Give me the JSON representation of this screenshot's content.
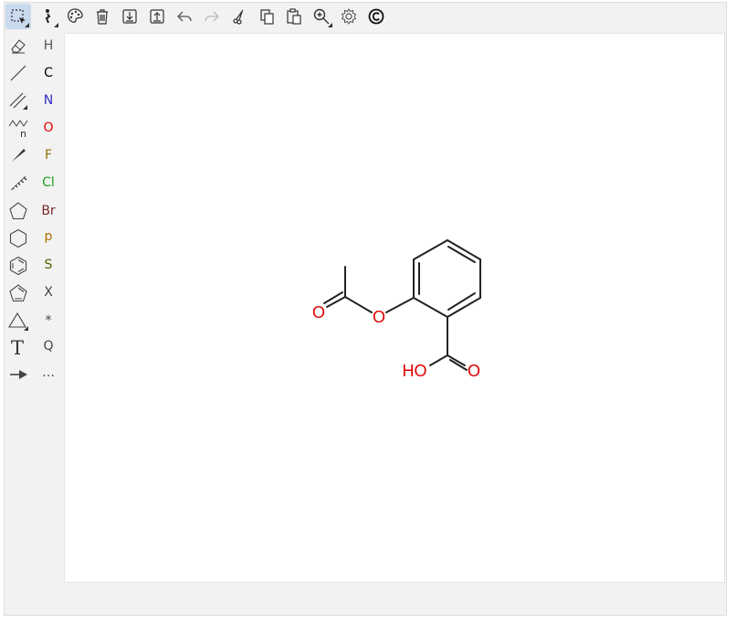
{
  "toolbar": {
    "items": [
      {
        "name": "select-tool",
        "icon": "dashed-select-icon",
        "active": true
      },
      {
        "name": "erase-tool",
        "icon": "bond-erase-icon"
      },
      {
        "name": "color-tool",
        "icon": "palette-icon"
      },
      {
        "name": "clear-tool",
        "icon": "trash-icon"
      },
      {
        "name": "open-tool",
        "icon": "download-icon"
      },
      {
        "name": "save-tool",
        "icon": "upload-icon"
      },
      {
        "name": "undo-tool",
        "icon": "undo-icon"
      },
      {
        "name": "redo-tool",
        "icon": "redo-icon"
      },
      {
        "name": "cut-tool",
        "icon": "scissors-icon"
      },
      {
        "name": "copy-tool",
        "icon": "copy-icon"
      },
      {
        "name": "paste-tool",
        "icon": "paste-icon"
      },
      {
        "name": "zoom-tool",
        "icon": "zoom-in-icon"
      },
      {
        "name": "settings-tool",
        "icon": "gear-icon"
      },
      {
        "name": "about-tool",
        "icon": "copyright-icon"
      }
    ]
  },
  "left_tools": [
    {
      "name": "eraser",
      "icon": "eraser-icon"
    },
    {
      "name": "single-bond",
      "icon": "single-bond-icon"
    },
    {
      "name": "double-bond",
      "icon": "double-bond-icon"
    },
    {
      "name": "chain",
      "icon": "chain-icon",
      "label": "n"
    },
    {
      "name": "wedge-bond",
      "icon": "wedge-bond-icon"
    },
    {
      "name": "hash-bond",
      "icon": "hash-bond-icon"
    },
    {
      "name": "cyclopentane",
      "icon": "pentagon-icon"
    },
    {
      "name": "cyclohexane",
      "icon": "hexagon-icon"
    },
    {
      "name": "benzene",
      "icon": "benzene-icon"
    },
    {
      "name": "cyclopentadiene",
      "icon": "cyclopentadiene-icon"
    },
    {
      "name": "shape",
      "icon": "triangle-icon"
    },
    {
      "name": "text",
      "icon": "text-icon",
      "label": "T"
    },
    {
      "name": "arrow",
      "icon": "arrow-icon"
    }
  ],
  "atoms": [
    {
      "label": "H",
      "color": "#555555"
    },
    {
      "label": "C",
      "color": "#000000"
    },
    {
      "label": "N",
      "color": "#3030c0"
    },
    {
      "label": "O",
      "color": "#e00000"
    },
    {
      "label": "F",
      "color": "#8a7000"
    },
    {
      "label": "Cl",
      "color": "#20a020"
    },
    {
      "label": "Br",
      "color": "#7a2a2a"
    },
    {
      "label": "p",
      "color": "#b07000"
    },
    {
      "label": "S",
      "color": "#5c5c00"
    },
    {
      "label": "X",
      "color": "#444444"
    },
    {
      "label": "*",
      "color": "#444444"
    },
    {
      "label": "Q",
      "color": "#444444"
    },
    {
      "label": "…",
      "color": "#444444"
    }
  ],
  "molecule": {
    "bond_color": "#222222",
    "hetero_color": "#e00000",
    "labels": {
      "ester_o": "O",
      "carbonyl_o": "O",
      "hydroxyl": "HO",
      "acid_o": "O"
    }
  }
}
